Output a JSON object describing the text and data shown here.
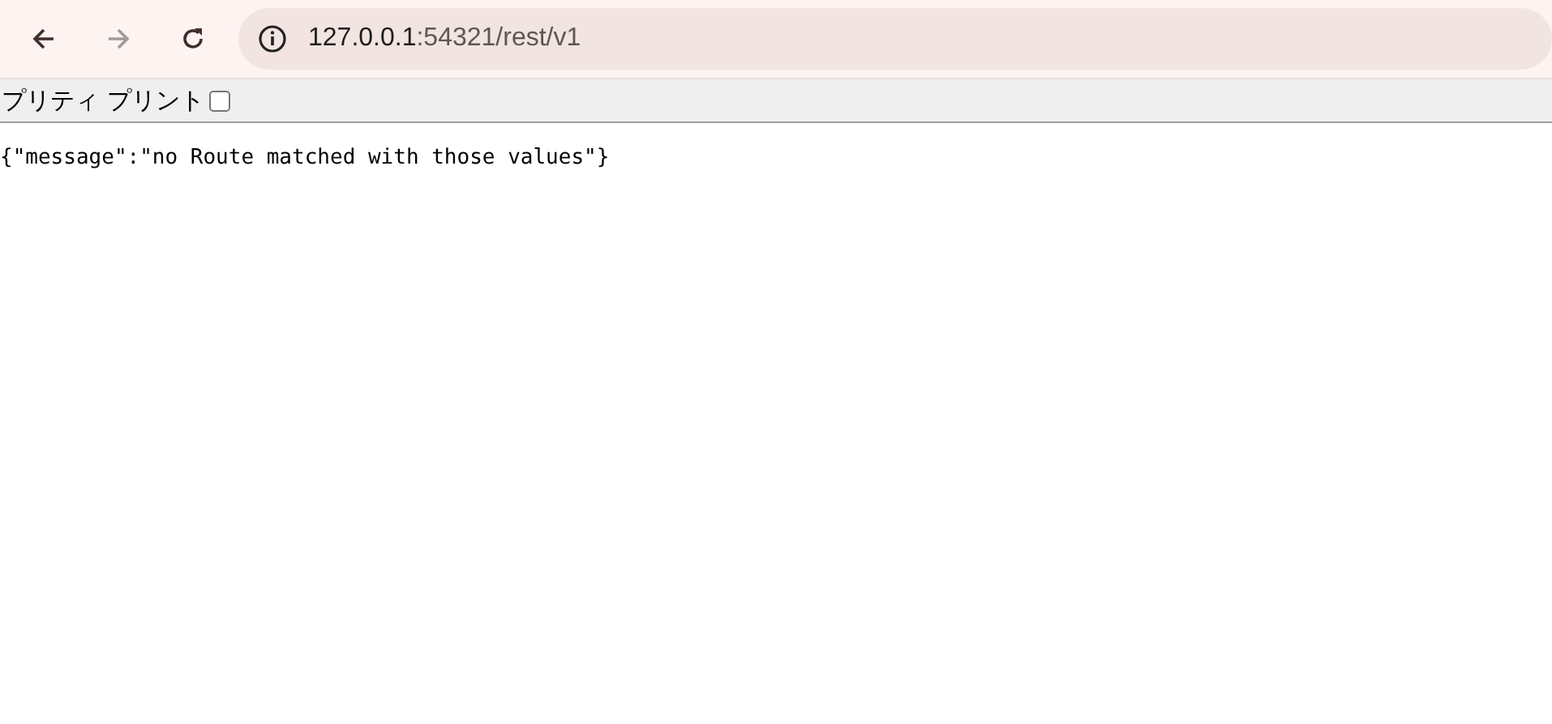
{
  "toolbar": {
    "buttons": [
      {
        "kind": "back",
        "disabled": false
      },
      {
        "kind": "forward",
        "disabled": true
      },
      {
        "kind": "reload",
        "disabled": false
      }
    ],
    "address": {
      "host": "127.0.0.1",
      "path": ":54321/rest/v1"
    }
  },
  "pretty_print": {
    "label": "プリティ プリント",
    "checked": false
  },
  "body_text": "{\"message\":\"no Route matched with those values\"}"
}
